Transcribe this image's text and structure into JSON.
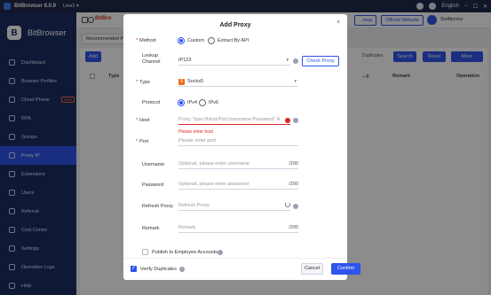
{
  "app": {
    "title": "BitBrowser 6.0.9",
    "line": "Line1 ▾",
    "language": "English",
    "window_controls": [
      "−",
      "☐",
      "✕"
    ]
  },
  "sidebar": {
    "brand": "BitBrowser",
    "items": [
      {
        "label": "Dashboard",
        "icon": "home-icon"
      },
      {
        "label": "Browser Profiles",
        "icon": "profiles-icon"
      },
      {
        "label": "Cloud Phone",
        "icon": "phone-icon",
        "badge": "NEW"
      },
      {
        "label": "RPA",
        "icon": "rpa-icon"
      },
      {
        "label": "Groups",
        "icon": "groups-icon"
      },
      {
        "label": "Proxy IP",
        "icon": "proxy-icon",
        "active": true
      },
      {
        "label": "Extensions",
        "icon": "extensions-icon"
      },
      {
        "label": "Users",
        "icon": "users-icon"
      },
      {
        "label": "Referral",
        "icon": "referral-icon"
      },
      {
        "label": "Cost Center",
        "icon": "cost-icon"
      },
      {
        "label": "Settings",
        "icon": "settings-icon"
      },
      {
        "label": "Operation Logs",
        "icon": "logs-icon"
      },
      {
        "label": "Help",
        "icon": "help-icon"
      }
    ]
  },
  "header": {
    "brand": "BitBro",
    "buttons": [
      "...mup",
      "Official Website"
    ],
    "user": "Swiftproxy"
  },
  "content": {
    "tab": "Recommended Pr...",
    "add_label": "Add",
    "duplicates_label": "Duplicates",
    "search_label": "Search",
    "reset_label": "Reset",
    "more_label": "More",
    "columns": [
      "Type",
      "...y",
      "Remark",
      "Operation"
    ]
  },
  "modal": {
    "title": "Add Proxy",
    "close_label": "×",
    "method": {
      "label": "Method",
      "options": [
        "Custom",
        "Extract By API"
      ],
      "selected": "Custom"
    },
    "lookup": {
      "label_line1": "Lookup",
      "label_line2": "Channel",
      "value": "IP123",
      "check_label": "Check Proxy"
    },
    "type": {
      "label": "Type",
      "value": "Socks5",
      "badge": "S"
    },
    "protocol": {
      "label": "Protocol",
      "options": [
        "IPv4",
        "IPv6"
      ],
      "selected": "IPv4"
    },
    "host": {
      "label": "Host",
      "placeholder": "Proxy Type://Host:Port:Username:Password\" A",
      "error": "Please enter host"
    },
    "port": {
      "label": "Port",
      "placeholder": "Please enter port"
    },
    "username": {
      "label": "Username",
      "placeholder": "Optional, please enter username",
      "counter": "/200"
    },
    "password": {
      "label": "Password",
      "placeholder": "Optional, please enter password",
      "counter": "/200"
    },
    "refresh": {
      "label": "Refresh Proxy",
      "placeholder": "Refresh Proxy"
    },
    "remark": {
      "label": "Remark",
      "placeholder": "Remark",
      "counter": "/200"
    },
    "publish_label": "Publish to Employee Accounts",
    "verify_label": "Verify Duplicates",
    "cancel_label": "Cancel",
    "confirm_label": "Confirm"
  },
  "colors": {
    "sidebar_bg": "#1d2e63",
    "accent": "#2f54eb",
    "error": "#e02424",
    "socks_badge": "#f06a1b"
  }
}
